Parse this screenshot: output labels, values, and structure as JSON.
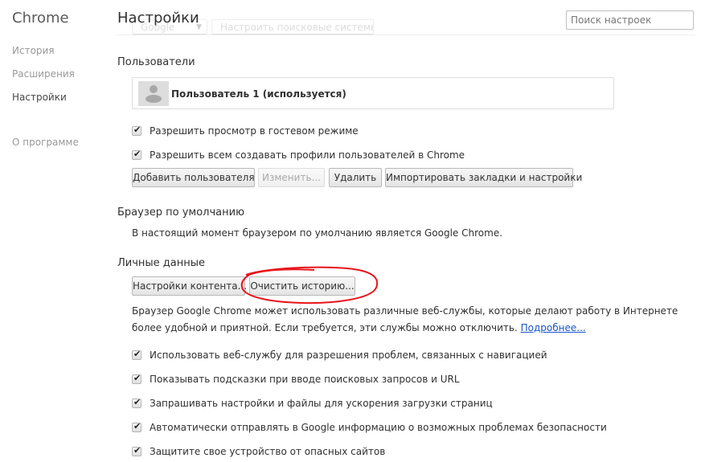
{
  "sidebar": {
    "brand": "Chrome",
    "items": [
      {
        "label": "История",
        "active": false
      },
      {
        "label": "Расширения",
        "active": false
      },
      {
        "label": "Настройки",
        "active": true
      },
      {
        "label": "О программе",
        "active": false
      }
    ]
  },
  "header": {
    "title": "Настройки",
    "search_placeholder": "Поиск настроек",
    "search_value": ""
  },
  "search_engine": {
    "selected": "Google",
    "manage_button": "Настроить поисковые системы..."
  },
  "users": {
    "title": "Пользователи",
    "profile_name": "Пользователь 1 (используется)",
    "checkboxes": [
      {
        "label": "Разрешить просмотр в гостевом режиме",
        "checked": true
      },
      {
        "label": "Разрешить всем создавать профили пользователей в Chrome",
        "checked": true
      }
    ],
    "buttons": {
      "add": "Добавить пользователя",
      "edit": "Изменить...",
      "delete": "Удалить",
      "import": "Импортировать закладки и настройки"
    }
  },
  "default_browser": {
    "title": "Браузер по умолчанию",
    "status": "В настоящий момент браузером по умолчанию является Google Chrome."
  },
  "privacy": {
    "title": "Личные данные",
    "buttons": {
      "content_settings": "Настройки контента...",
      "clear_history": "Очистить историю..."
    },
    "description_line1": "Браузер Google Chrome может использовать различные веб-службы, которые делают работу в Интернете",
    "description_line2": "более удобной и приятной. Если требуется, эти службы можно отключить.",
    "learn_more": "Подробнее...",
    "checkboxes": [
      {
        "label": "Использовать веб-службу для разрешения проблем, связанных с навигацией",
        "checked": true
      },
      {
        "label": "Показывать подсказки при вводе поисковых запросов и URL",
        "checked": true
      },
      {
        "label": "Запрашивать настройки и файлы для ускорения загрузки страниц",
        "checked": true
      },
      {
        "label": "Автоматически отправлять в Google информацию о возможных проблемах безопасности",
        "checked": true
      },
      {
        "label": "Защитите свое устройство от опасных сайтов",
        "checked": true
      }
    ]
  },
  "annotation": {
    "color": "#e8141b",
    "target": "clear_history"
  }
}
